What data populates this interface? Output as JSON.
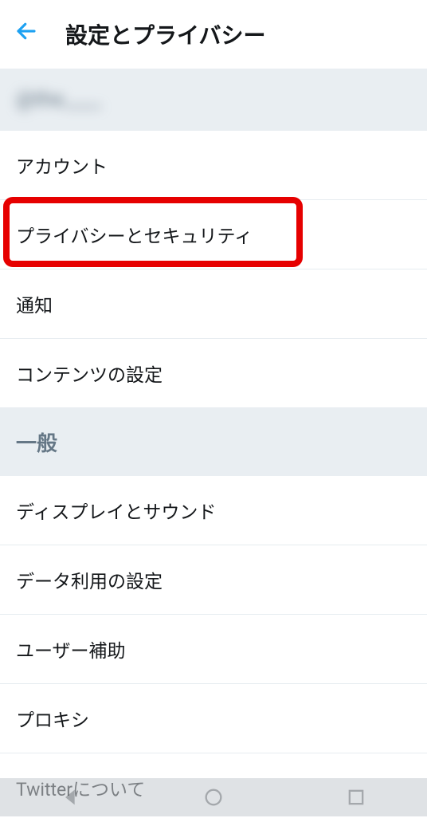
{
  "header": {
    "title": "設定とプライバシー"
  },
  "account": {
    "username": "@the____"
  },
  "section1": {
    "items": [
      {
        "label": "アカウント"
      },
      {
        "label": "プライバシーとセキュリティ",
        "highlighted": true
      },
      {
        "label": "通知"
      },
      {
        "label": "コンテンツの設定"
      }
    ]
  },
  "section2": {
    "label": "一般",
    "items": [
      {
        "label": "ディスプレイとサウンド"
      },
      {
        "label": "データ利用の設定"
      },
      {
        "label": "ユーザー補助"
      },
      {
        "label": "プロキシ"
      },
      {
        "label": "Twitterについて"
      }
    ]
  }
}
